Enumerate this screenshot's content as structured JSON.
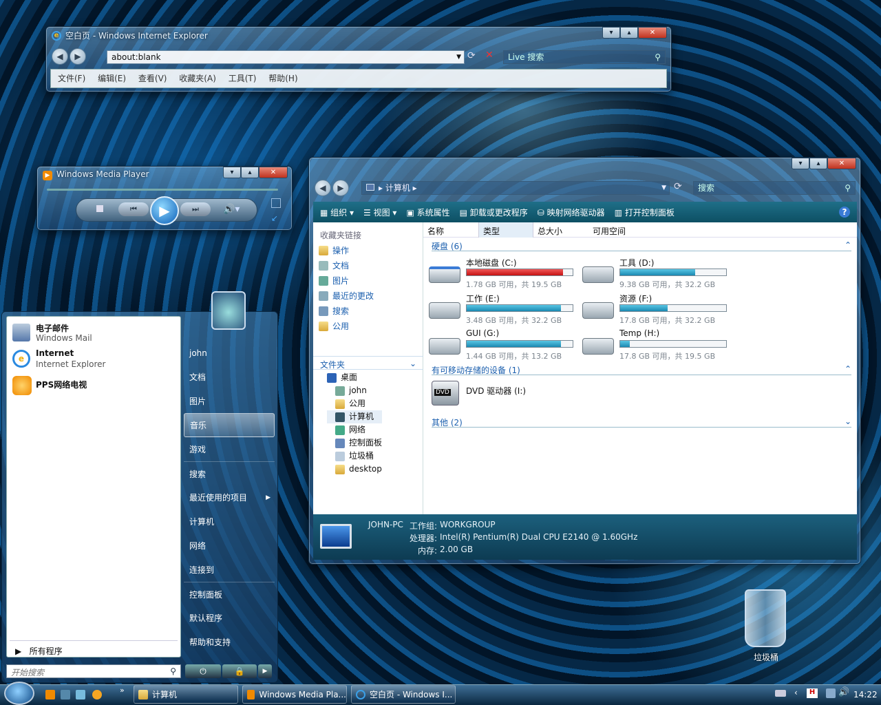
{
  "ie": {
    "title": "空白页 - Windows Internet Explorer",
    "address": "about:blank",
    "search_placeholder": "Live 搜索",
    "menu": [
      "文件(F)",
      "编辑(E)",
      "查看(V)",
      "收藏夹(A)",
      "工具(T)",
      "帮助(H)"
    ]
  },
  "wmp": {
    "title": "Windows Media Player"
  },
  "explorer": {
    "breadcrumb": "计算机",
    "search_placeholder": "搜索",
    "toolbar": [
      "组织",
      "视图",
      "系统属性",
      "卸载或更改程序",
      "映射网络驱动器",
      "打开控制面板"
    ],
    "favorites_header": "收藏夹链接",
    "favorites": [
      "操作",
      "文档",
      "图片",
      "最近的更改",
      "搜索",
      "公用"
    ],
    "folders_header": "文件夹",
    "tree": [
      "桌面",
      "john",
      "公用",
      "计算机",
      "网络",
      "控制面板",
      "垃圾桶",
      "desktop"
    ],
    "columns": [
      "名称",
      "类型",
      "总大小",
      "可用空间"
    ],
    "group_hdd": "硬盘 (6)",
    "drives": [
      {
        "name": "本地磁盘 (C:)",
        "info": "1.78 GB 可用，共 19.5 GB",
        "used": 0.91
      },
      {
        "name": "工具 (D:)",
        "info": "9.38 GB 可用，共 32.2 GB",
        "used": 0.71
      },
      {
        "name": "工作 (E:)",
        "info": "3.48 GB 可用，共 32.2 GB",
        "used": 0.89
      },
      {
        "name": "资源 (F:)",
        "info": "17.8 GB 可用，共 32.2 GB",
        "used": 0.45
      },
      {
        "name": "GUI (G:)",
        "info": "1.44 GB 可用，共 13.2 GB",
        "used": 0.89
      },
      {
        "name": "Temp (H:)",
        "info": "17.8 GB 可用，共 19.5 GB",
        "used": 0.09
      }
    ],
    "group_removable": "有可移动存储的设备 (1)",
    "dvd": "DVD 驱动器 (I:)",
    "dvd_badge": "DVD",
    "group_other": "其他 (2)",
    "details": {
      "pc": "JOHN-PC",
      "wg_label": "工作组:",
      "wg": "WORKGROUP",
      "cpu_label": "处理器:",
      "cpu": "Intel(R) Pentium(R) Dual  CPU  E2140  @ 1.60GHz",
      "mem_label": "内存:",
      "mem": "2.00 GB"
    }
  },
  "start": {
    "pinned": [
      {
        "title": "电子邮件",
        "sub": "Windows Mail"
      },
      {
        "title": "Internet",
        "sub": "Internet Explorer"
      },
      {
        "title": "PPS网络电视",
        "sub": ""
      }
    ],
    "all_programs": "所有程序",
    "search_placeholder": "开始搜索",
    "right": [
      "john",
      "文档",
      "图片",
      "音乐",
      "游戏",
      "搜索",
      "最近使用的项目",
      "计算机",
      "网络",
      "连接到",
      "控制面板",
      "默认程序",
      "帮助和支持"
    ]
  },
  "desktop": {
    "recycle": "垃圾桶"
  },
  "taskbar": {
    "buttons": [
      "计算机",
      "Windows Media Pla...",
      "空白页 - Windows I..."
    ],
    "clock": "14:22"
  }
}
